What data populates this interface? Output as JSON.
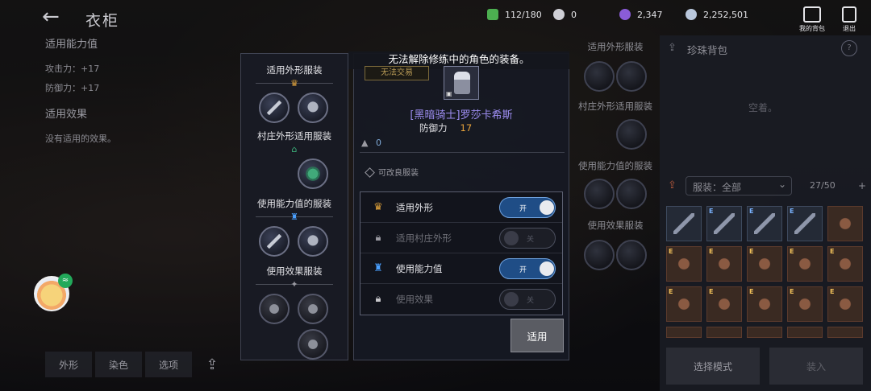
{
  "header": {
    "back": "←",
    "title": "衣柜"
  },
  "currencies": [
    {
      "icon": "green-gem-icon",
      "value": "112/180",
      "color": "#4caf50"
    },
    {
      "icon": "pearl-icon",
      "value": "0",
      "color": "#cfcfd6"
    },
    {
      "icon": "purple-orb-icon",
      "value": "2,347",
      "color": "#8a5cd8"
    },
    {
      "icon": "silver-coin-icon",
      "value": "2,252,501",
      "color": "#b9c7dc"
    }
  ],
  "top_buttons": {
    "my_bag": "我的背包",
    "exit": "退出"
  },
  "left_info": {
    "section_stats": "适用能力值",
    "attack": "攻击力：+17",
    "defense": "防御力：+17",
    "section_effect": "适用效果",
    "no_effect": "没有适用的效果。"
  },
  "bottom_tabs": [
    "外形",
    "染色",
    "选项"
  ],
  "slots_panel": {
    "appearance_header": "适用外形服装",
    "village_header": "村庄外形适用服装",
    "stats_header": "使用能力值的服装",
    "effect_header": "使用效果服装"
  },
  "dialog": {
    "title": "无法解除修练中的角色的装备。",
    "trade_tag": "无法交易",
    "item_name": "[黑暗骑士]罗莎卡希斯",
    "defense_label": "防御力",
    "defense_value": "17",
    "weight_value": "0",
    "upgrade_label": "可改良服装",
    "options": [
      {
        "label": "适用外形",
        "toggle": "开",
        "state": "on"
      },
      {
        "label": "适用村庄外形",
        "toggle": "关",
        "state": "off"
      },
      {
        "label": "使用能力值",
        "toggle": "开",
        "state": "on"
      },
      {
        "label": "使用效果",
        "toggle": "关",
        "state": "off"
      }
    ],
    "apply": "适用"
  },
  "right_col": {
    "appearance_header": "适用外形服装",
    "village_header": "村庄外形适用服装",
    "stats_header": "使用能力值的服装",
    "effect_header": "使用效果服装"
  },
  "inventory": {
    "title": "珍珠背包",
    "help": "?",
    "empty": "空着。",
    "filter": "服装：全部",
    "capacity": "27/50",
    "add": "+",
    "select_mode": "选择模式",
    "load": "装入",
    "cell_badge": "E"
  }
}
